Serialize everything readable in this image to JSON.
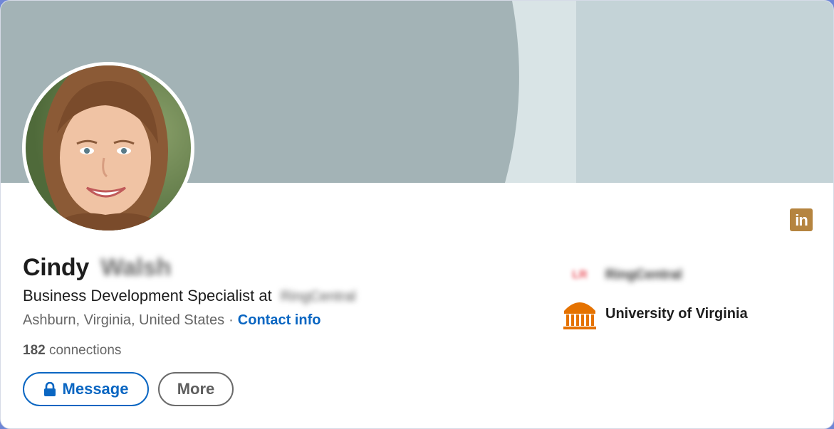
{
  "profile": {
    "first_name": "Cindy",
    "last_name": "Walsh",
    "headline_prefix": "Business Development Specialist at",
    "headline_company": "RingCentral",
    "location": "Ashburn, Virginia, United States",
    "separator": "·",
    "contact_info_label": "Contact info",
    "connections_count": "182",
    "connections_label": "connections"
  },
  "actions": {
    "message_label": "Message",
    "more_label": "More"
  },
  "side": {
    "company_logo_text": "LR",
    "company_name": "RingCentral",
    "school_name": "University of Virginia"
  },
  "brand": {
    "linkedin_badge": "in"
  },
  "colors": {
    "accent": "#0a66c2",
    "banner_left": "#a2b2b5",
    "banner_right": "#c3d3d8",
    "linkedin_badge": "#b5843f",
    "school_orange": "#e57200"
  },
  "icons": [
    "lock-icon",
    "linkedin-icon",
    "university-icon"
  ]
}
